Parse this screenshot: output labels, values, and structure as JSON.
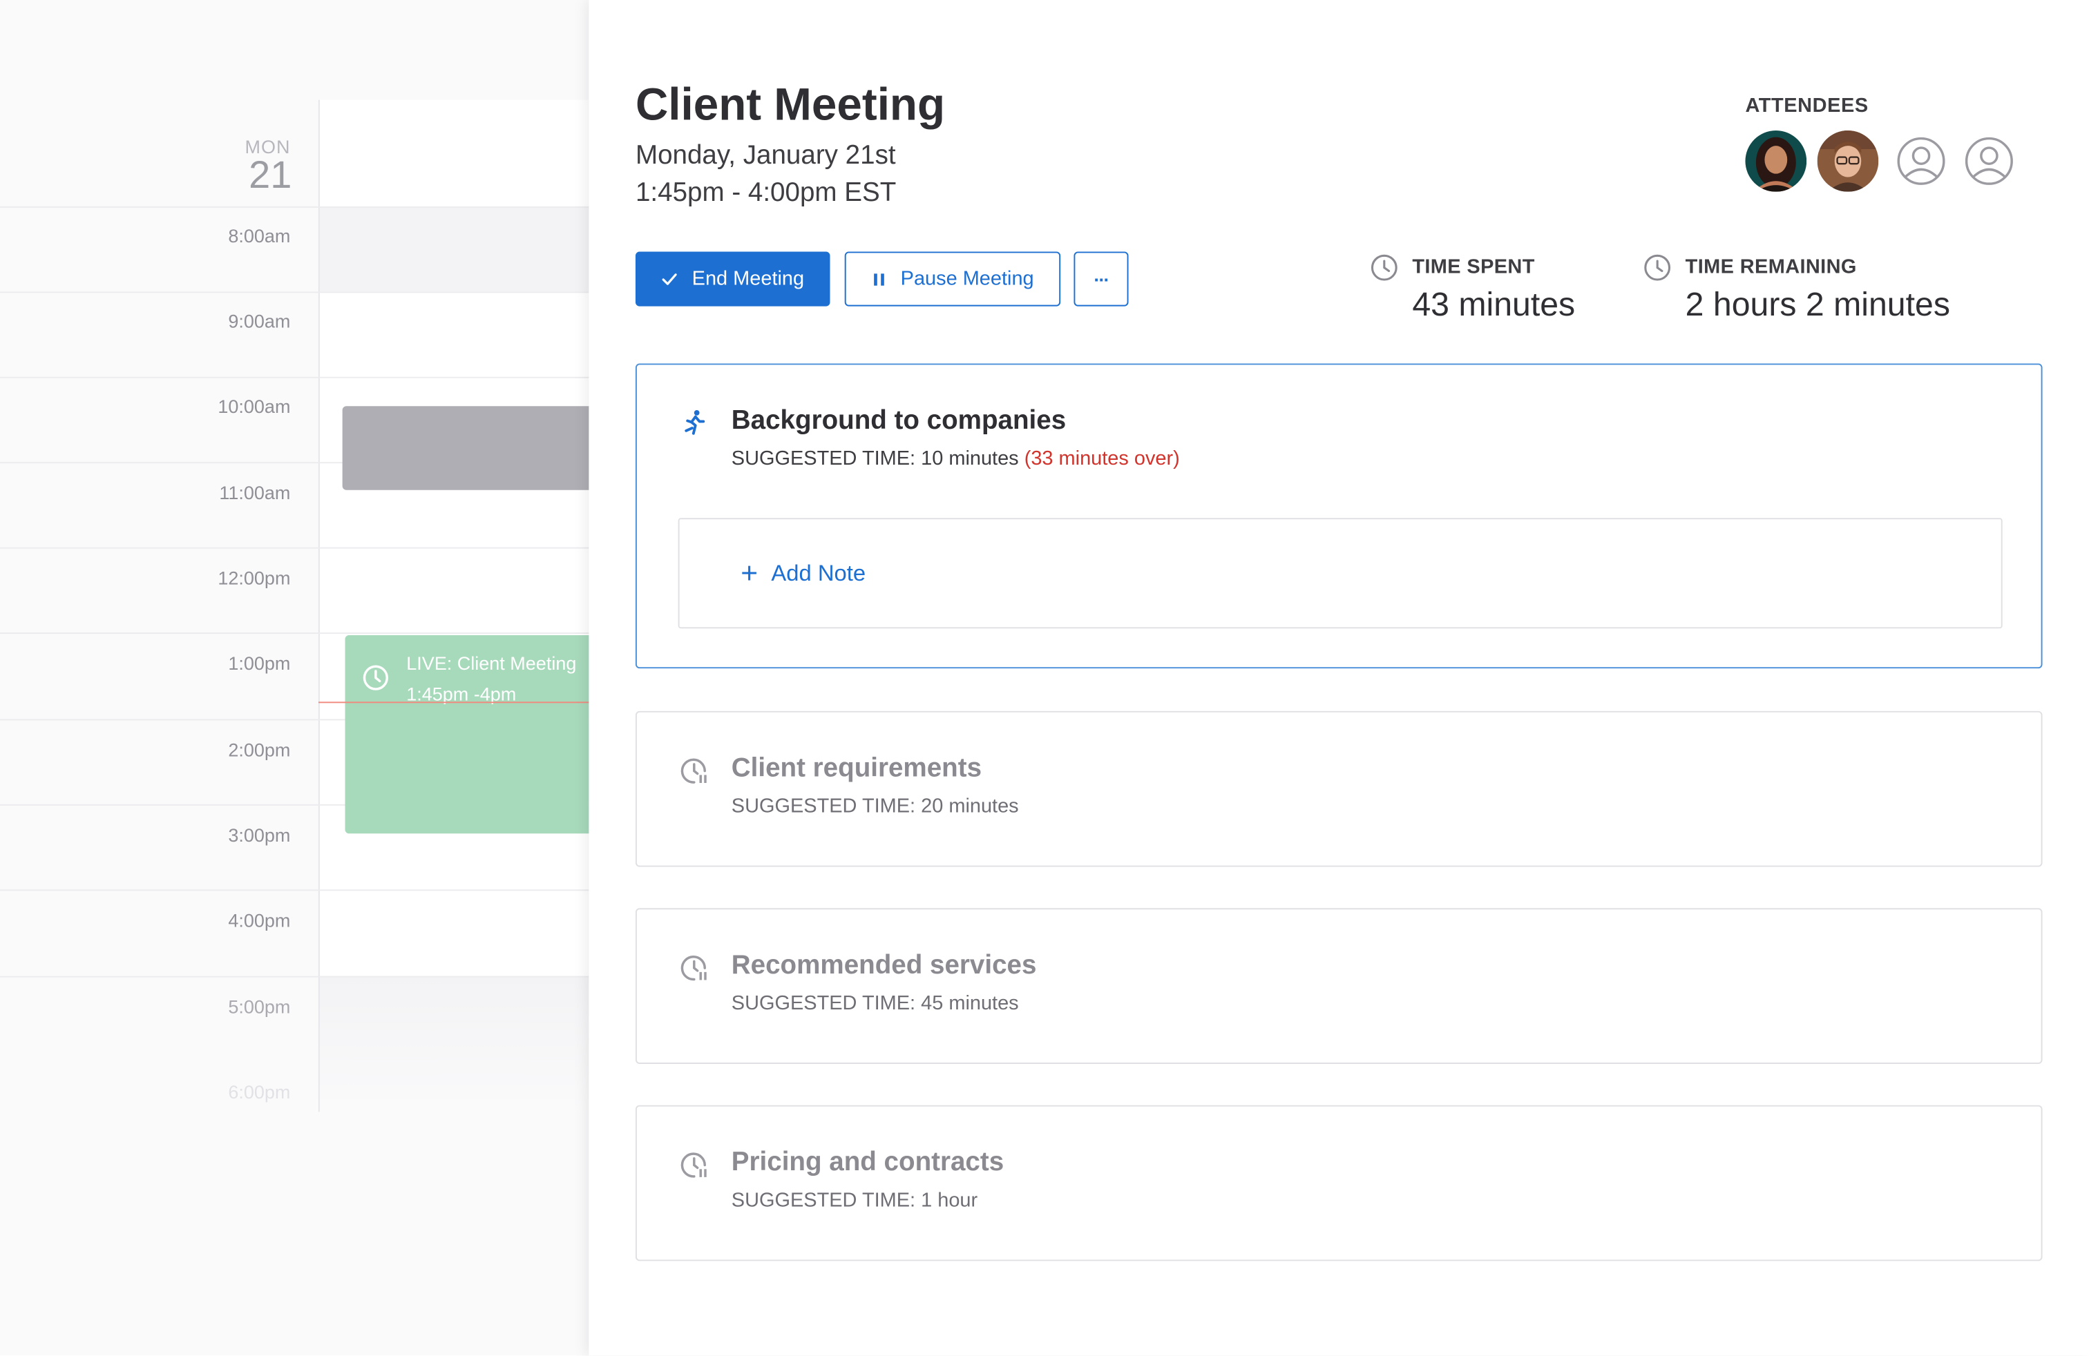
{
  "calendar": {
    "day_of_week": "MON",
    "day_number": "21",
    "hours": [
      "8:00am",
      "9:00am",
      "10:00am",
      "11:00am",
      "12:00pm",
      "1:00pm",
      "2:00pm",
      "3:00pm",
      "4:00pm",
      "5:00pm",
      "6:00pm"
    ],
    "live_event": {
      "title": "LIVE: Client Meeting",
      "time": "1:45pm -4pm"
    }
  },
  "meeting": {
    "title": "Client Meeting",
    "date": "Monday, January 21st",
    "time_range": "1:45pm - 4:00pm EST"
  },
  "actions": {
    "end_label": "End Meeting",
    "pause_label": "Pause Meeting",
    "more_label": "···"
  },
  "attendees": {
    "label": "ATTENDEES"
  },
  "stats": {
    "spent_label": "TIME SPENT",
    "spent_value": "43 minutes",
    "remaining_label": "TIME REMAINING",
    "remaining_value": "2 hours 2 minutes"
  },
  "agenda": [
    {
      "title": "Background to companies",
      "suggested": "SUGGESTED TIME: 10 minutes",
      "over": "(33 minutes over)",
      "add_note_label": "Add Note"
    },
    {
      "title": "Client requirements",
      "suggested": "SUGGESTED TIME: 20 minutes"
    },
    {
      "title": "Recommended services",
      "suggested": "SUGGESTED TIME: 45 minutes"
    },
    {
      "title": "Pricing and contracts",
      "suggested": "SUGGESTED TIME: 1 hour"
    }
  ],
  "colors": {
    "accent": "#1d6fd1",
    "live_event": "#a7d9bb",
    "over_time": "#d0342c",
    "now_line": "#f08a7e"
  }
}
